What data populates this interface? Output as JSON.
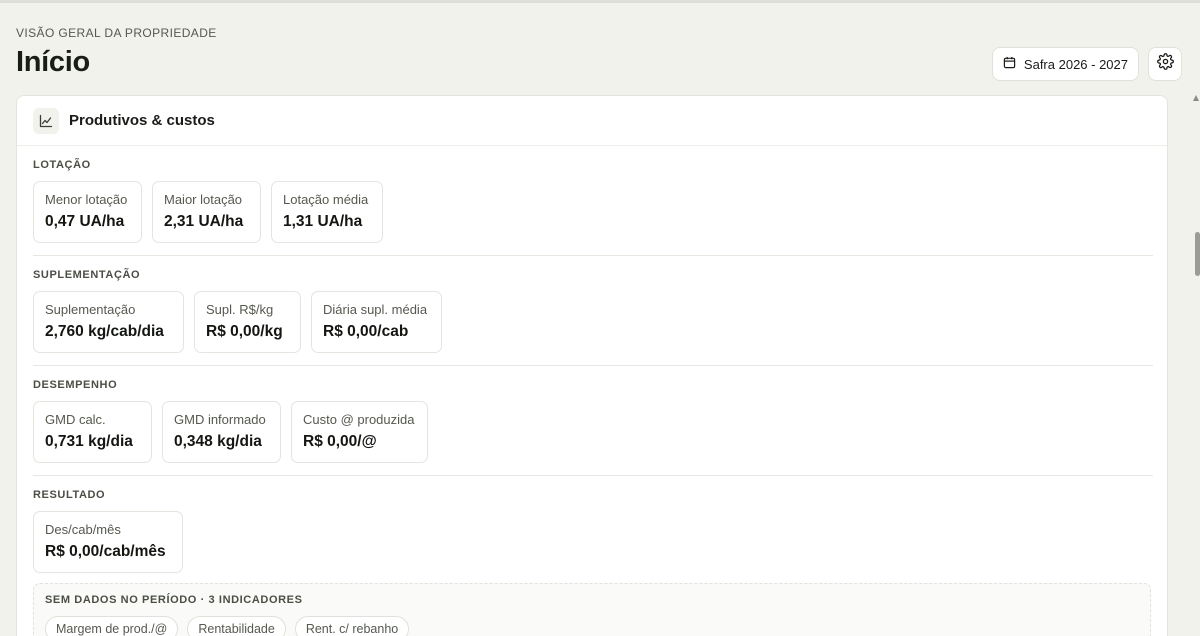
{
  "header": {
    "eyebrow": "VISÃO GERAL DA PROPRIEDADE",
    "title": "Início"
  },
  "actions": {
    "season_label": "Safra 2026 - 2027",
    "calendar_icon": "calendar-icon",
    "settings_icon": "gear-icon"
  },
  "card": {
    "title": "Produtivos & custos",
    "icon": "line-chart-icon"
  },
  "sections": {
    "lotacao": {
      "label": "LOTAÇÃO",
      "tiles": [
        {
          "label": "Menor lotação",
          "value": "0,47 UA/ha"
        },
        {
          "label": "Maior lotação",
          "value": "2,31 UA/ha"
        },
        {
          "label": "Lotação média",
          "value": "1,31 UA/ha"
        }
      ]
    },
    "suplementacao": {
      "label": "SUPLEMENTAÇÃO",
      "tiles": [
        {
          "label": "Suplementação",
          "value": "2,760 kg/cab/dia"
        },
        {
          "label": "Supl. R$/kg",
          "value": "R$ 0,00/kg"
        },
        {
          "label": "Diária supl. média",
          "value": "R$ 0,00/cab"
        }
      ]
    },
    "desempenho": {
      "label": "DESEMPENHO",
      "tiles": [
        {
          "label": "GMD calc.",
          "value": "0,731 kg/dia"
        },
        {
          "label": "GMD informado",
          "value": "0,348 kg/dia"
        },
        {
          "label": "Custo @ produzida",
          "value": "R$ 0,00/@"
        }
      ]
    },
    "resultado": {
      "label": "RESULTADO",
      "tiles": [
        {
          "label": "Des/cab/mês",
          "value": "R$ 0,00/cab/mês"
        }
      ]
    }
  },
  "empty": {
    "label": "SEM DADOS NO PERÍODO · 3 INDICADORES",
    "chips": [
      "Margem de prod./@",
      "Rentabilidade",
      "Rent. c/ rebanho"
    ]
  }
}
